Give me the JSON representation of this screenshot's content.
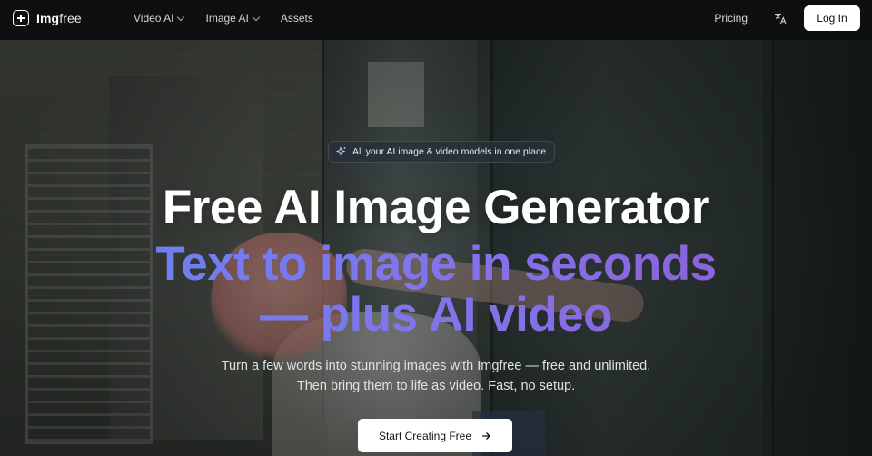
{
  "nav": {
    "logo_bold": "Img",
    "logo_light": "free",
    "menu": [
      {
        "label": "Video AI",
        "has_dropdown": true
      },
      {
        "label": "Image AI",
        "has_dropdown": true
      },
      {
        "label": "Assets",
        "has_dropdown": false
      }
    ],
    "pricing": "Pricing",
    "language_icon": "translate-icon",
    "login": "Log In"
  },
  "hero": {
    "badge": "All your AI image & video models in one place",
    "badge_icon": "sparkle-icon",
    "title": "Free AI Image Generator",
    "subtitle_line1": "Text to image in seconds",
    "subtitle_line2": "— plus AI video",
    "description_line1": "Turn a few words into stunning images with Imgfree — free and unlimited.",
    "description_line2": "Then bring them to life as video. Fast, no setup.",
    "cta": "Start Creating Free",
    "cta_icon": "arrow-right-icon"
  },
  "colors": {
    "nav_bg": "#0e0f11",
    "accent_gradient_start": "#6f7ff2",
    "accent_gradient_end": "#8a64d9",
    "button_bg": "#ffffff"
  }
}
